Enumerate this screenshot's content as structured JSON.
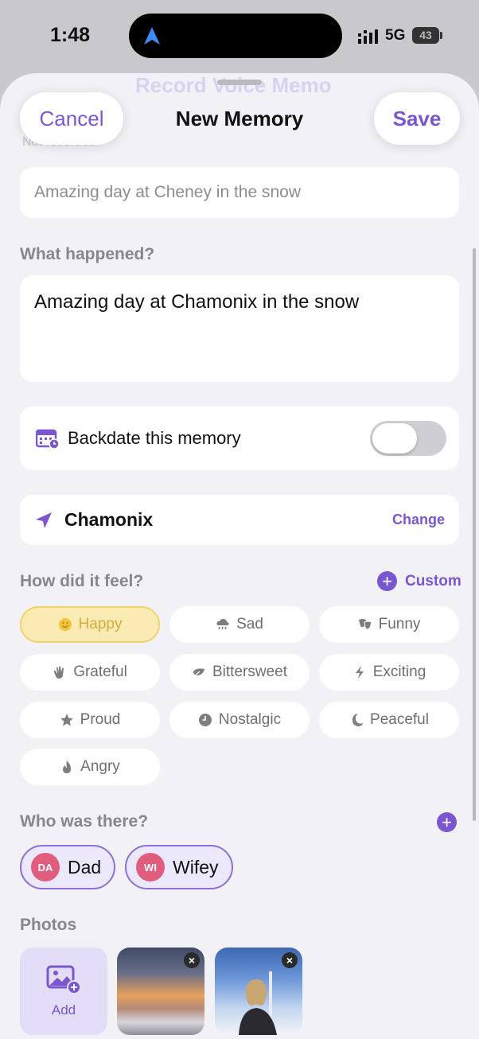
{
  "status": {
    "time": "1:48",
    "network": "5G",
    "battery": "43"
  },
  "background_ghost": {
    "title": "Record Voice Memo",
    "sub": "Not recorded"
  },
  "nav": {
    "cancel": "Cancel",
    "title": "New Memory",
    "save": "Save"
  },
  "title_field": {
    "placeholder": "Amazing day at Cheney in the snow"
  },
  "description": {
    "label": "What happened?",
    "value": "Amazing day at Chamonix in the snow"
  },
  "backdate": {
    "label": "Backdate this memory",
    "enabled": false
  },
  "location": {
    "name": "Chamonix",
    "change_label": "Change"
  },
  "feelings": {
    "label": "How did it feel?",
    "custom_label": "Custom",
    "selected": "Happy",
    "moods": [
      {
        "label": "Happy",
        "icon": "smile-icon"
      },
      {
        "label": "Sad",
        "icon": "rain-cloud-icon"
      },
      {
        "label": "Funny",
        "icon": "theater-masks-icon"
      },
      {
        "label": "Grateful",
        "icon": "clapping-hands-icon"
      },
      {
        "label": "Bittersweet",
        "icon": "leaf-icon"
      },
      {
        "label": "Exciting",
        "icon": "bolt-icon"
      },
      {
        "label": "Proud",
        "icon": "star-icon"
      },
      {
        "label": "Nostalgic",
        "icon": "clock-icon"
      },
      {
        "label": "Peaceful",
        "icon": "moon-icon"
      },
      {
        "label": "Angry",
        "icon": "flame-icon"
      }
    ]
  },
  "people": {
    "label": "Who was there?",
    "list": [
      {
        "initials": "DA",
        "name": "Dad"
      },
      {
        "initials": "WI",
        "name": "Wifey"
      }
    ]
  },
  "photos": {
    "label": "Photos",
    "add_label": "Add",
    "count": 2
  },
  "colors": {
    "accent": "#7a57d1",
    "selected_mood_bg": "#faeab3",
    "avatar": "#e05d7d"
  }
}
